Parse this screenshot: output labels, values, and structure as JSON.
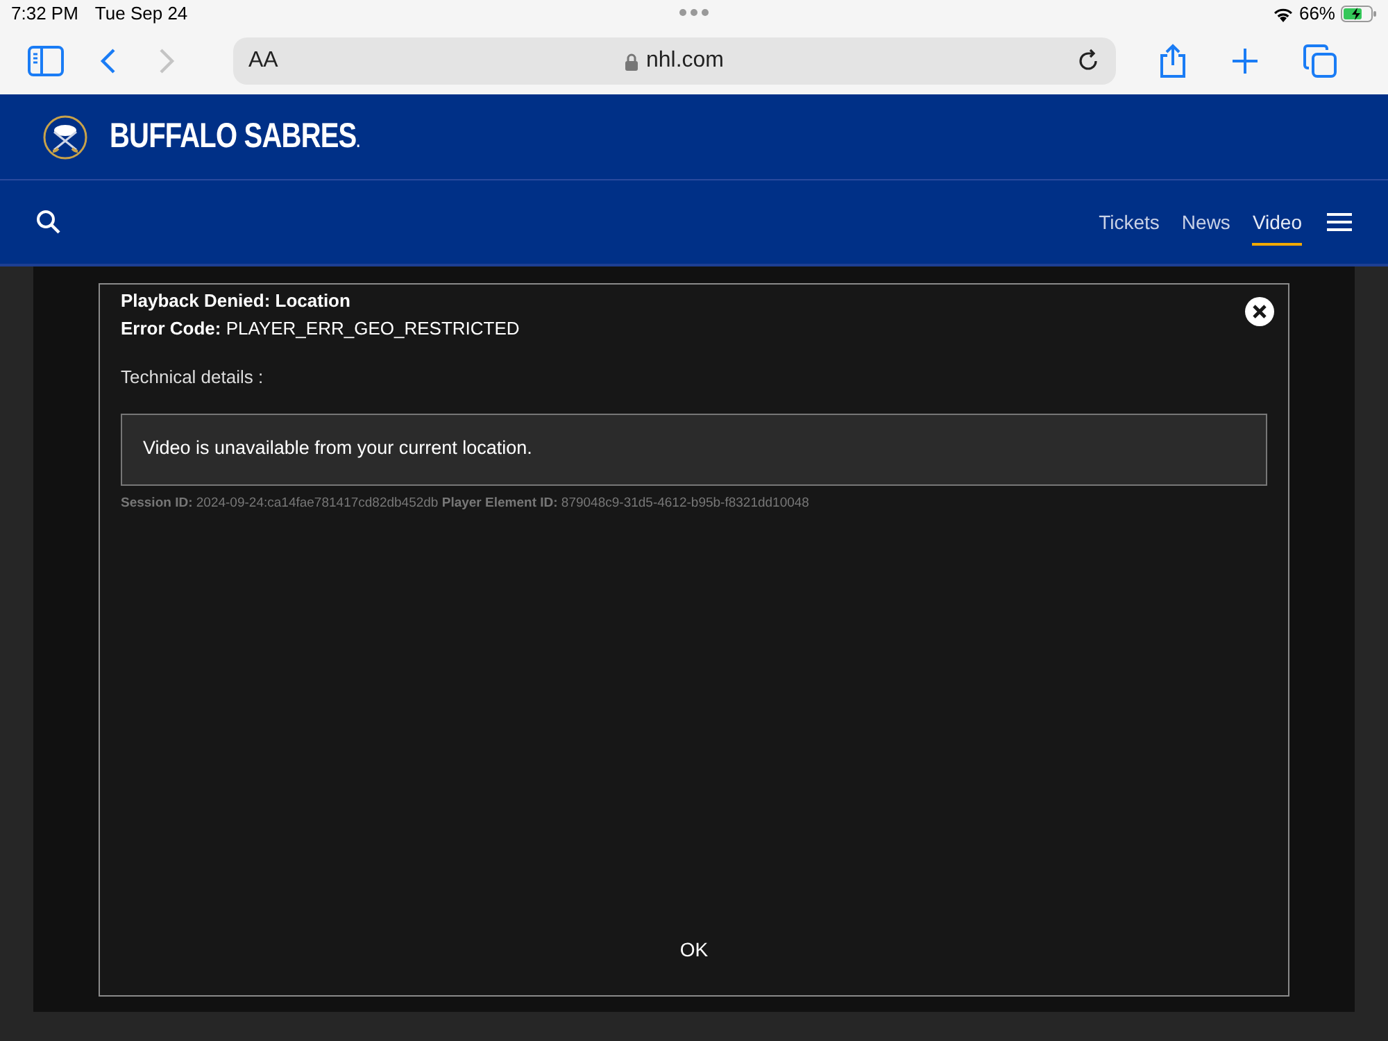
{
  "status_bar": {
    "time": "7:32 PM",
    "date": "Tue Sep 24",
    "battery": "66%"
  },
  "browser": {
    "text_size": "AA",
    "address": "nhl.com"
  },
  "site_header": {
    "brand": "BUFFALO SABRES",
    "brand_mark": "."
  },
  "nav": {
    "items": [
      {
        "label": "Tickets",
        "selected": false
      },
      {
        "label": "News",
        "selected": false
      },
      {
        "label": "Video",
        "selected": true
      }
    ]
  },
  "error_dialog": {
    "title": "Playback Denied: Location",
    "error_code": "**Error Code:** PLAYER_ERR_GEO_RESTRICTED",
    "details_label": "Technical details :",
    "details": "Video is unavailable from your current location.",
    "session": "**Session ID:** 2024-09-24:ca14fae781417cd82db452db **Player Element ID:** 879048c9-31d5-4612-b95b-f8321dd10048",
    "ok": "OK"
  }
}
